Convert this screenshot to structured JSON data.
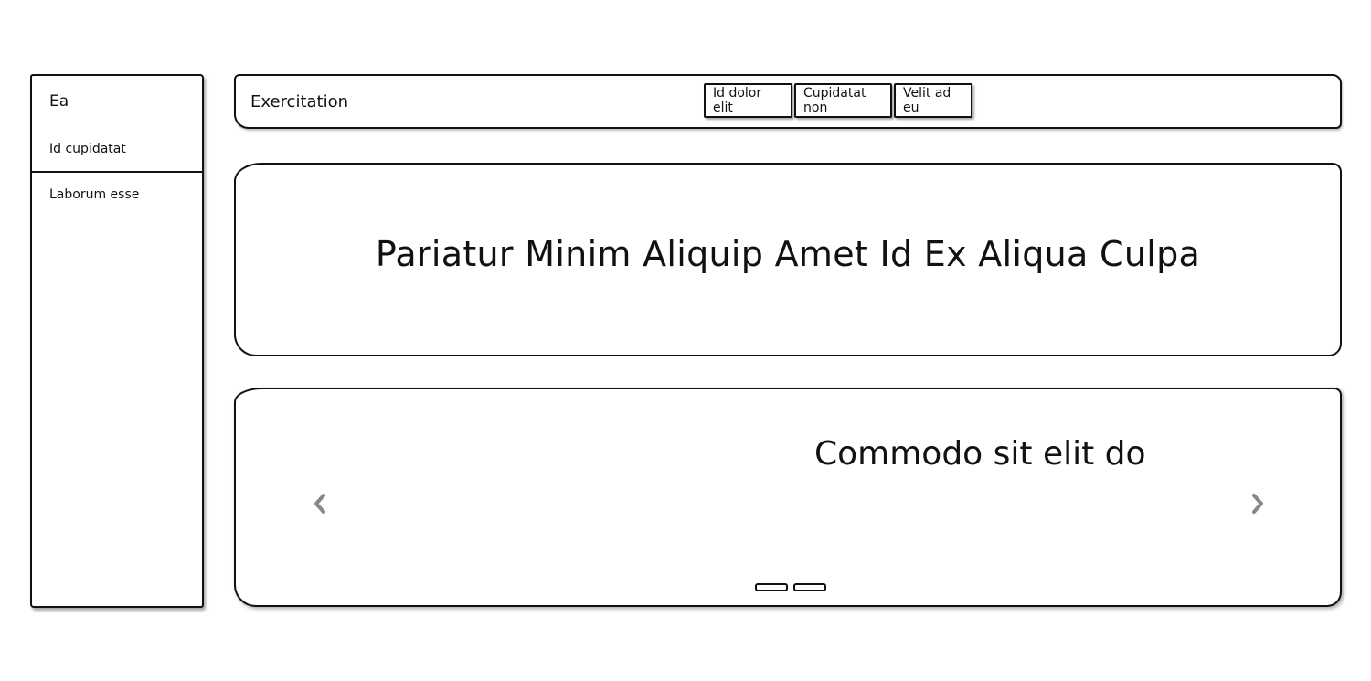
{
  "sidebar": {
    "brand": "Ea",
    "items": [
      {
        "label": "Id cupidatat"
      },
      {
        "label": "Laborum esse"
      }
    ]
  },
  "topbar": {
    "title": "Exercitation",
    "buttons": [
      {
        "label": "Id dolor elit"
      },
      {
        "label": "Cupidatat non"
      },
      {
        "label": "Velit ad eu"
      }
    ]
  },
  "hero": {
    "title": "Pariatur Minim Aliquip Amet Id Ex Aliqua Culpa"
  },
  "carousel": {
    "caption": "Commodo sit elit do",
    "prev_icon": "chevron-left-icon",
    "next_icon": "chevron-right-icon",
    "slide_count": 2,
    "arrow_color": "#888888"
  }
}
